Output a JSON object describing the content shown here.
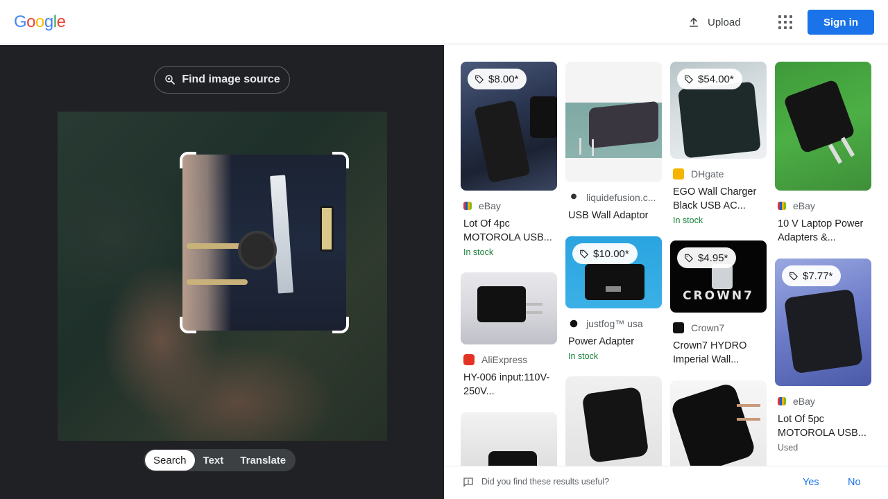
{
  "header": {
    "logo_letters": [
      "G",
      "o",
      "o",
      "g",
      "l",
      "e"
    ],
    "logo_colors": [
      "#4285F4",
      "#EA4335",
      "#FBBC05",
      "#4285F4",
      "#34A853",
      "#EA4335"
    ],
    "upload_label": "Upload",
    "signin_label": "Sign in"
  },
  "left": {
    "find_source_label": "Find image source",
    "tabs": [
      {
        "label": "Search",
        "active": true
      },
      {
        "label": "Text",
        "active": false
      },
      {
        "label": "Translate",
        "active": false
      }
    ]
  },
  "results": [
    {
      "price": "$8.00*",
      "source": "eBay",
      "source_icon": "ebay-icon",
      "title": "Lot Of 4pc MOTOROLA USB...",
      "status": "In stock"
    },
    {
      "price": "",
      "source": "liquidefusion.c...",
      "source_icon": "liquidefusion-icon",
      "title": "USB Wall Adaptor",
      "status": ""
    },
    {
      "price": "$54.00*",
      "source": "DHgate",
      "source_icon": "dhgate-icon",
      "title": "EGO Wall Charger Black USB AC...",
      "status": "In stock"
    },
    {
      "price": "",
      "source": "eBay",
      "source_icon": "ebay-icon",
      "title": "10 V Laptop Power Adapters &...",
      "status": ""
    },
    {
      "price": "",
      "source": "AliExpress",
      "source_icon": "aliexpress-icon",
      "title": "HY-006 input:110V-250V...",
      "status": ""
    },
    {
      "price": "$10.00*",
      "source": "justfog™ usa",
      "source_icon": "justfog-icon",
      "title": "Power Adapter",
      "status": "In stock"
    },
    {
      "price": "$4.95*",
      "source": "Crown7",
      "source_icon": "crown7-icon",
      "title": "Crown7 HYDRO Imperial Wall...",
      "status": ""
    },
    {
      "price": "$7.77*",
      "source": "eBay",
      "source_icon": "ebay-icon",
      "title": "Lot Of 5pc MOTOROLA USB...",
      "status": "Used"
    }
  ],
  "thumb_texts": {
    "crown7_banner": "CROWN7"
  },
  "feedback": {
    "question": "Did you find these results useful?",
    "yes_label": "Yes",
    "no_label": "No"
  }
}
